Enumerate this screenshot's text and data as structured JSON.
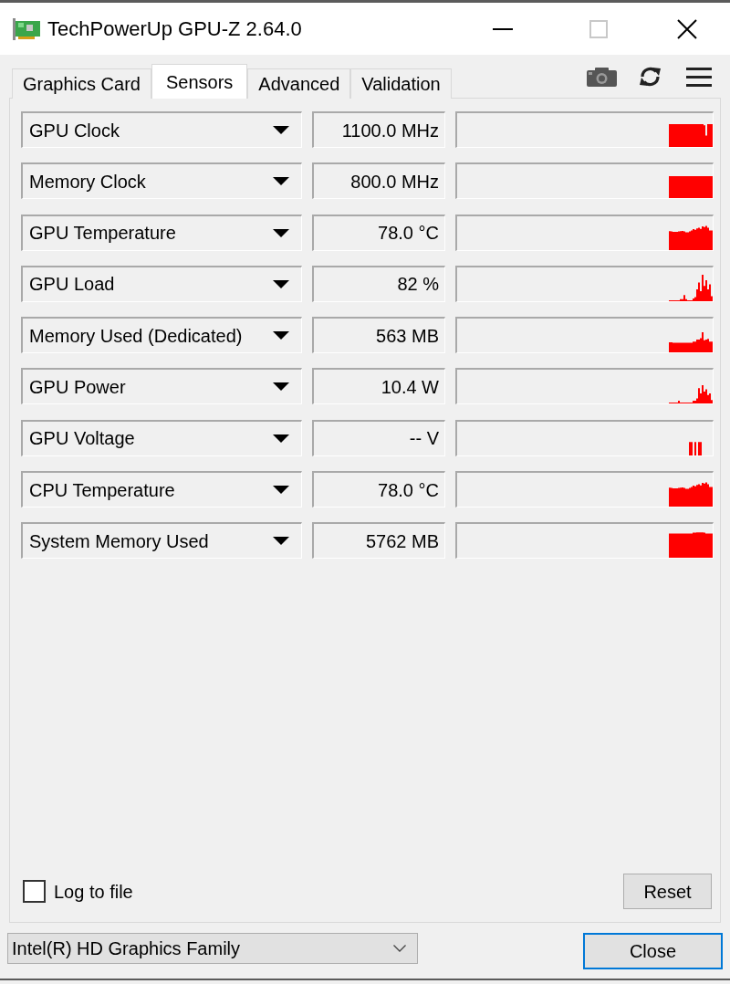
{
  "window": {
    "title": "TechPowerUp GPU-Z 2.64.0",
    "maximize_disabled": true
  },
  "tabs": [
    {
      "label": "Graphics Card",
      "selected": false
    },
    {
      "label": "Sensors",
      "selected": true
    },
    {
      "label": "Advanced",
      "selected": false
    },
    {
      "label": "Validation",
      "selected": false
    }
  ],
  "sensors": [
    {
      "name": "GPU Clock",
      "value": "1100.0 MHz"
    },
    {
      "name": "Memory Clock",
      "value": "800.0 MHz"
    },
    {
      "name": "GPU Temperature",
      "value": "78.0 °C"
    },
    {
      "name": "GPU Load",
      "value": "82 %"
    },
    {
      "name": "Memory Used (Dedicated)",
      "value": "563 MB"
    },
    {
      "name": "GPU Power",
      "value": "10.4 W"
    },
    {
      "name": "GPU Voltage",
      "value": "-- V"
    },
    {
      "name": "CPU Temperature",
      "value": "78.0 °C"
    },
    {
      "name": "System Memory Used",
      "value": "5762 MB"
    }
  ],
  "log_to_file": {
    "label": "Log to file",
    "checked": false
  },
  "reset_button": "Reset",
  "gpu_select": {
    "value": "Intel(R) HD Graphics Family"
  },
  "close_button": "Close"
}
